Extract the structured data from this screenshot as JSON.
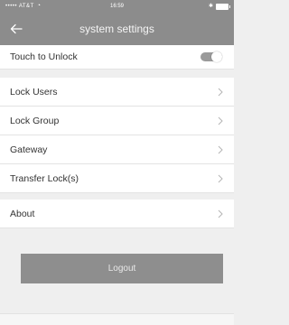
{
  "status_bar": {
    "carrier": "••••• AT&T",
    "time": "16:59"
  },
  "nav": {
    "title": "system settings"
  },
  "settings": {
    "touch_to_unlock": {
      "label": "Touch to Unlock",
      "enabled": true
    },
    "items": [
      {
        "label": "Lock Users"
      },
      {
        "label": "Lock Group"
      },
      {
        "label": "Gateway"
      },
      {
        "label": "Transfer Lock(s)"
      }
    ],
    "about": {
      "label": "About"
    }
  },
  "logout_label": "Logout",
  "colors": {
    "header": "#8c8c8c",
    "background": "#efefef",
    "row": "#ffffff",
    "logout_button": "#8e8e8e",
    "toggle_track": "#9a9a9a"
  },
  "icons": [
    "wifi-icon",
    "bluetooth-icon",
    "battery-icon",
    "back-arrow-icon",
    "chevron-right-icon"
  ]
}
